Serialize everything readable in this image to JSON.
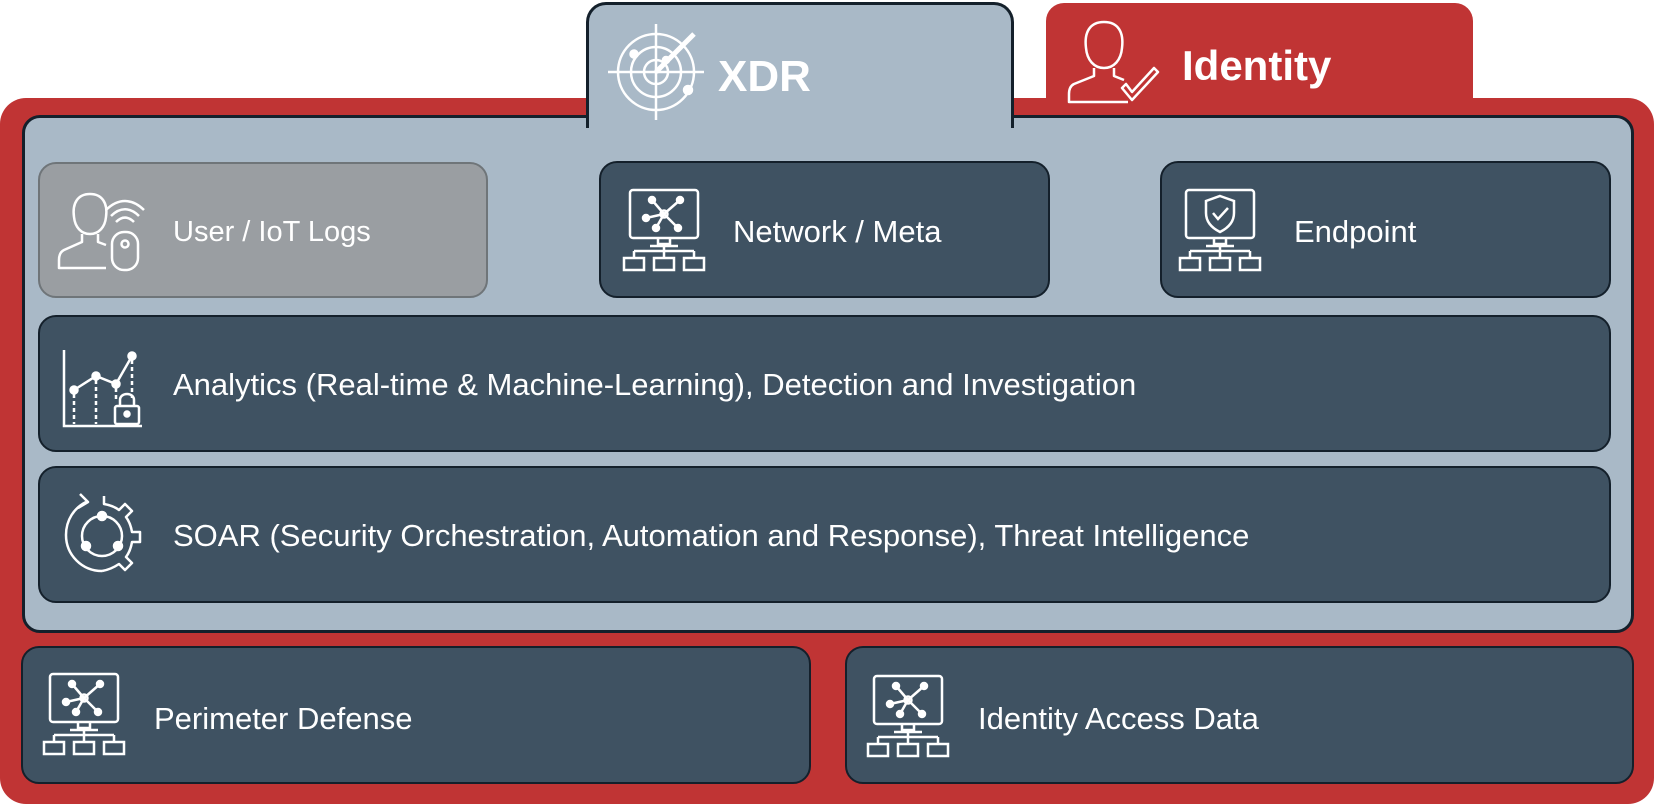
{
  "colors": {
    "red": "#c03434",
    "gray": "#a9b9c7",
    "dark": "#3f5262",
    "light": "#9a9ea2",
    "white": "#ffffff"
  },
  "tabs": {
    "xdr": {
      "label": "XDR",
      "icon": "radar-icon"
    },
    "identity": {
      "label": "Identity",
      "icon": "user-check-icon"
    }
  },
  "sources": [
    {
      "label": "User / IoT Logs",
      "icon": "user-iot-icon"
    },
    {
      "label": "Network / Meta",
      "icon": "network-monitor-icon"
    },
    {
      "label": "Endpoint",
      "icon": "shield-monitor-icon"
    }
  ],
  "layers": [
    {
      "label": "Analytics (Real-time & Machine-Learning), Detection and Investigation",
      "icon": "analytics-chart-icon"
    },
    {
      "label": "SOAR (Security Orchestration, Automation and Response), Threat Intelligence",
      "icon": "automation-gear-icon"
    }
  ],
  "bottom": [
    {
      "label": "Perimeter Defense",
      "icon": "network-monitor-icon"
    },
    {
      "label": "Identity Access Data",
      "icon": "network-monitor-icon"
    }
  ]
}
